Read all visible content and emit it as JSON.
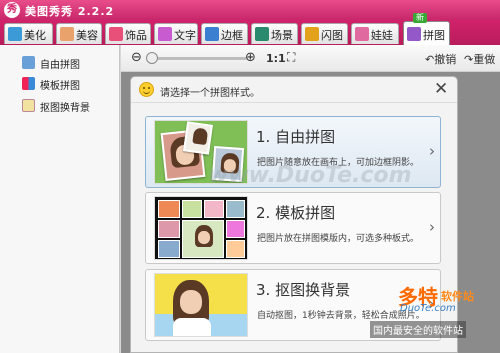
{
  "app": {
    "logo_text": "秀",
    "title": "美图秀秀 2.2.2"
  },
  "tabs": [
    {
      "label": "美化",
      "icon": "landscape-icon",
      "color": "#3c9bd6"
    },
    {
      "label": "美容",
      "icon": "face-icon",
      "color": "#e9a26b"
    },
    {
      "label": "饰品",
      "icon": "heart-icon",
      "color": "#e8507a"
    },
    {
      "label": "文字",
      "icon": "text-icon",
      "color": "#c85bd0"
    },
    {
      "label": "边框",
      "icon": "frame-icon",
      "color": "#3a7fd0"
    },
    {
      "label": "场景",
      "icon": "scene-icon",
      "color": "#2a8a6e"
    },
    {
      "label": "闪图",
      "icon": "flash-icon",
      "color": "#e4a21c"
    },
    {
      "label": "娃娃",
      "icon": "doll-icon",
      "color": "#e06aa0"
    },
    {
      "label": "拼图",
      "icon": "puzzle-icon",
      "color": "#9458c8"
    }
  ],
  "active_tab": "拼图",
  "new_badge": "新",
  "left_panel": [
    {
      "label": "自由拼图",
      "icon": "free-puzzle-icon"
    },
    {
      "label": "模板拼图",
      "icon": "template-puzzle-icon"
    },
    {
      "label": "抠图换背景",
      "icon": "cutout-icon"
    }
  ],
  "toolbar": {
    "zoom_level": "1:1",
    "undo_label": "撤销",
    "redo_label": "重做"
  },
  "dialog": {
    "title": "请选择一个拼图样式。"
  },
  "options": [
    {
      "title": "1. 自由拼图",
      "desc": "把图片随意放在画布上，可加边框阴影。"
    },
    {
      "title": "2. 模板拼图",
      "desc": "把图片放在拼图模版内，可选多种板式。"
    },
    {
      "title": "3. 抠图换背景",
      "desc": "自动抠图，1秒钟去背景，轻松合成照片。"
    }
  ],
  "watermark": {
    "url_text": "www.DuoTe.com",
    "site_name": "多特",
    "site_sub": "软件站",
    "site_url": "DuoTe.com",
    "slogan": "国内最安全的软件站"
  },
  "colors": {
    "brand": "#d3246c",
    "selected_card": "#dde8f2"
  }
}
